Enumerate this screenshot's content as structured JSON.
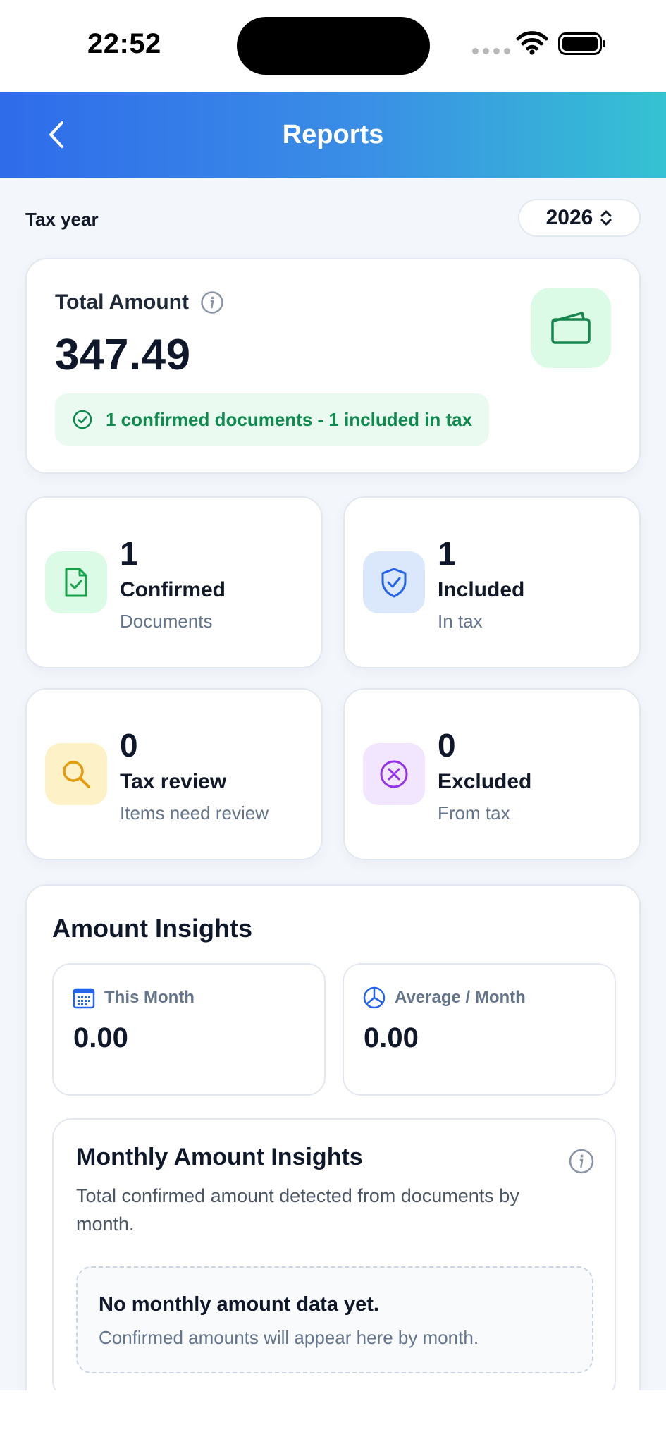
{
  "status_bar": {
    "time": "22:52"
  },
  "header": {
    "title": "Reports"
  },
  "tax_year": {
    "label": "Tax year",
    "value": "2026"
  },
  "total": {
    "title": "Total Amount",
    "amount": "347.49",
    "badge": "1 confirmed documents - 1 included in tax"
  },
  "stats": [
    {
      "count": "1",
      "label": "Confirmed",
      "sub": "Documents",
      "icon": "document-check-icon",
      "tile_color": "#dcfbe7",
      "icon_color": "#16a34a"
    },
    {
      "count": "1",
      "label": "Included",
      "sub": "In tax",
      "icon": "shield-check-icon",
      "tile_color": "#dbe8fc",
      "icon_color": "#2563eb"
    },
    {
      "count": "0",
      "label": "Tax review",
      "sub": "Items need review",
      "icon": "search-icon",
      "tile_color": "#fdf1c7",
      "icon_color": "#e49b0f"
    },
    {
      "count": "0",
      "label": "Excluded",
      "sub": "From tax",
      "icon": "x-circle-icon",
      "tile_color": "#f1e6fd",
      "icon_color": "#9333ea"
    }
  ],
  "insights": {
    "title": "Amount Insights",
    "this_month": {
      "label": "This Month",
      "value": "0.00",
      "icon": "calendar-icon"
    },
    "average": {
      "label": "Average / Month",
      "value": "0.00",
      "icon": "pie-chart-icon"
    },
    "monthly": {
      "title": "Monthly Amount Insights",
      "description": "Total confirmed amount detected from documents by month.",
      "empty_title": "No monthly amount data yet.",
      "empty_subtitle": "Confirmed amounts will appear here by month."
    }
  },
  "colors": {
    "header_start": "#2f6bea",
    "header_end": "#35c2d2",
    "success": "#0f8a4e",
    "accent_blue": "#2563eb"
  }
}
